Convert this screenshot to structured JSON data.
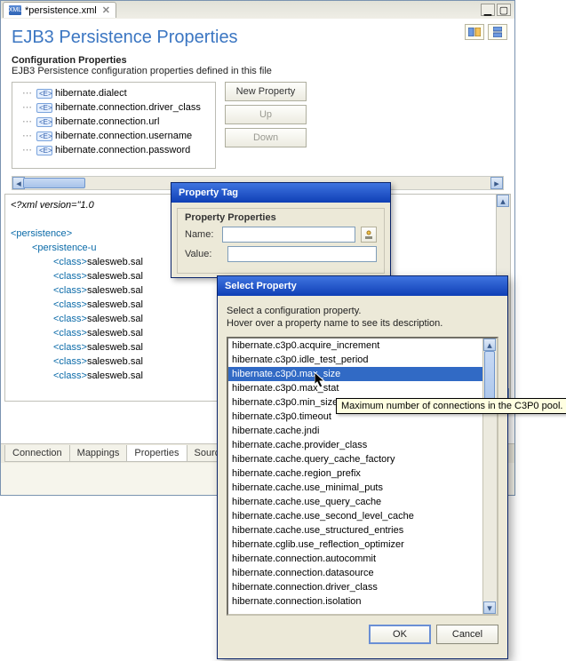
{
  "tab": {
    "filename": "*persistence.xml",
    "icon": "XML"
  },
  "window_buttons": {
    "min": "▁",
    "max": "▢"
  },
  "form": {
    "title": "EJB3 Persistence Properties",
    "section_label": "Configuration Properties",
    "section_desc": "EJB3 Persistence configuration properties defined in this file"
  },
  "tree": {
    "items": [
      "hibernate.dialect",
      "hibernate.connection.driver_class",
      "hibernate.connection.url",
      "hibernate.connection.username",
      "hibernate.connection.password"
    ],
    "pill": "<E>"
  },
  "buttons": {
    "new": "New Property",
    "up": "Up",
    "down": "Down"
  },
  "source": {
    "lines": [
      {
        "cls": "xml-decl",
        "text": "<?xml version=\"1.0"
      },
      {
        "cls": "",
        "text": " "
      },
      {
        "cls": "tag",
        "text": "<persistence>"
      },
      {
        "cls": "indent1",
        "text": "<persistence-u"
      },
      {
        "cls": "indent2",
        "text": "<class>salesweb.sal"
      },
      {
        "cls": "indent2",
        "text": "<class>salesweb.sal"
      },
      {
        "cls": "indent2",
        "text": "<class>salesweb.sal"
      },
      {
        "cls": "indent2",
        "text": "<class>salesweb.sal"
      },
      {
        "cls": "indent2",
        "text": "<class>salesweb.sal"
      },
      {
        "cls": "indent2",
        "text": "<class>salesweb.sal"
      },
      {
        "cls": "indent2",
        "text": "<class>salesweb.sal"
      },
      {
        "cls": "indent2",
        "text": "<class>salesweb.sal"
      },
      {
        "cls": "indent2",
        "text": "<class>salesweb.sal"
      }
    ]
  },
  "bottom_tabs": [
    "Connection",
    "Mappings",
    "Properties",
    "Source"
  ],
  "active_bottom_tab": 2,
  "dlg_propertytag": {
    "title": "Property Tag",
    "group": "Property Properties",
    "name_label": "Name:",
    "value_label": "Value:",
    "name_value": "",
    "value_value": ""
  },
  "dlg_select": {
    "title": "Select Property",
    "hint1": "Select a configuration property.",
    "hint2": "Hover over a property name to see its description.",
    "items": [
      "hibernate.c3p0.acquire_increment",
      "hibernate.c3p0.idle_test_period",
      "hibernate.c3p0.max_size",
      "hibernate.c3p0.max_stat",
      "hibernate.c3p0.min_size",
      "hibernate.c3p0.timeout",
      "hibernate.cache.jndi",
      "hibernate.cache.provider_class",
      "hibernate.cache.query_cache_factory",
      "hibernate.cache.region_prefix",
      "hibernate.cache.use_minimal_puts",
      "hibernate.cache.use_query_cache",
      "hibernate.cache.use_second_level_cache",
      "hibernate.cache.use_structured_entries",
      "hibernate.cglib.use_reflection_optimizer",
      "hibernate.connection.autocommit",
      "hibernate.connection.datasource",
      "hibernate.connection.driver_class",
      "hibernate.connection.isolation"
    ],
    "selected_index": 2,
    "ok": "OK",
    "cancel": "Cancel"
  },
  "tooltip": "Maximum number of connections in the C3P0 pool."
}
